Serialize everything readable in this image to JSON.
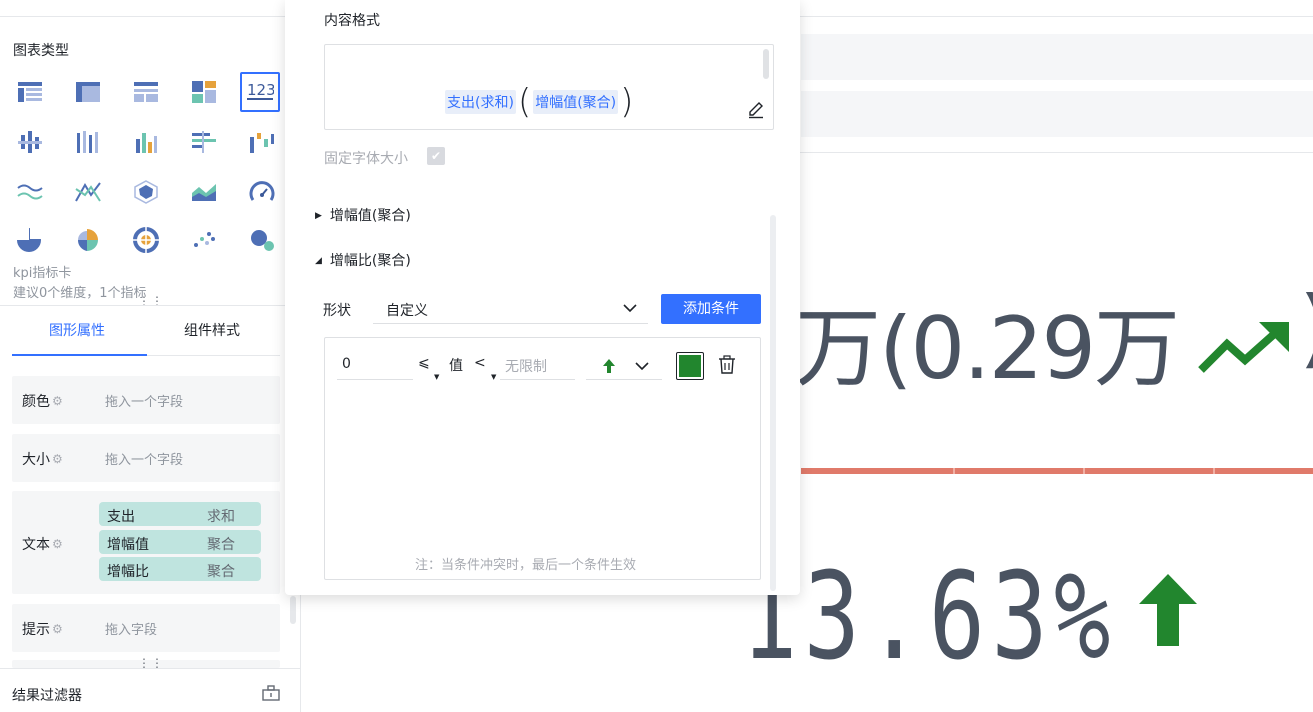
{
  "left_panel": {
    "chart_type_title": "图表类型",
    "selected_chart_name": "kpi指标卡",
    "selected_chart_hint": "建议0个维度，1个指标",
    "drag_dots": "⋮⋮",
    "tabs": [
      {
        "label": "图形属性",
        "active": true
      },
      {
        "label": "组件样式",
        "active": false
      }
    ],
    "props": {
      "color": {
        "label": "颜色",
        "placeholder": "拖入一个字段"
      },
      "size": {
        "label": "大小",
        "placeholder": "拖入一个字段"
      },
      "text": {
        "label": "文本",
        "fields": [
          {
            "name": "支出",
            "agg": "求和"
          },
          {
            "name": "增幅值",
            "agg": "聚合"
          },
          {
            "name": "增幅比",
            "agg": "聚合"
          }
        ]
      },
      "tooltip": {
        "label": "提示",
        "placeholder": "拖入字段"
      }
    },
    "filter_title": "结果过滤器"
  },
  "popup": {
    "content_format_title": "内容格式",
    "expression_tokens": [
      "支出(求和)",
      "增幅值(聚合)"
    ],
    "paren_open": "(",
    "paren_close": ")",
    "fixed_font_label": "固定字体大小",
    "fixed_font_checked": true,
    "section_collapsed": "增幅值(聚合)",
    "section_expanded": "增幅比(聚合)",
    "shape_label": "形状",
    "shape_value": "自定义",
    "add_condition_label": "添加条件",
    "condition": {
      "min_value": "0",
      "op_left": "⩽",
      "value_label": "值",
      "op_right": "<",
      "max_placeholder": "无限制",
      "icon": "arrow-up-icon",
      "color": "#22862e"
    },
    "note": "注：当条件冲突时，最后一个条件生效"
  },
  "preview": {
    "top_value_text": "万(0.29万",
    "top_close_paren": ")",
    "bottom_value_text": "13.63%",
    "accent_green": "#22862e",
    "line_red": "#e07a6a"
  },
  "chart_type_icons": [
    "table-icon",
    "cross-table-icon",
    "detail-table-icon",
    "block-icon",
    "kpi-icon",
    "grouped-bar-icon",
    "stacked-bar-icon",
    "column-icon",
    "bar-h-icon",
    "waterfall-icon",
    "area-wave-icon",
    "line-icon",
    "radar-icon",
    "area-icon",
    "gauge-icon",
    "pie-icon",
    "rose-icon",
    "sunburst-icon",
    "scatter-icon",
    "bubble-icon"
  ]
}
